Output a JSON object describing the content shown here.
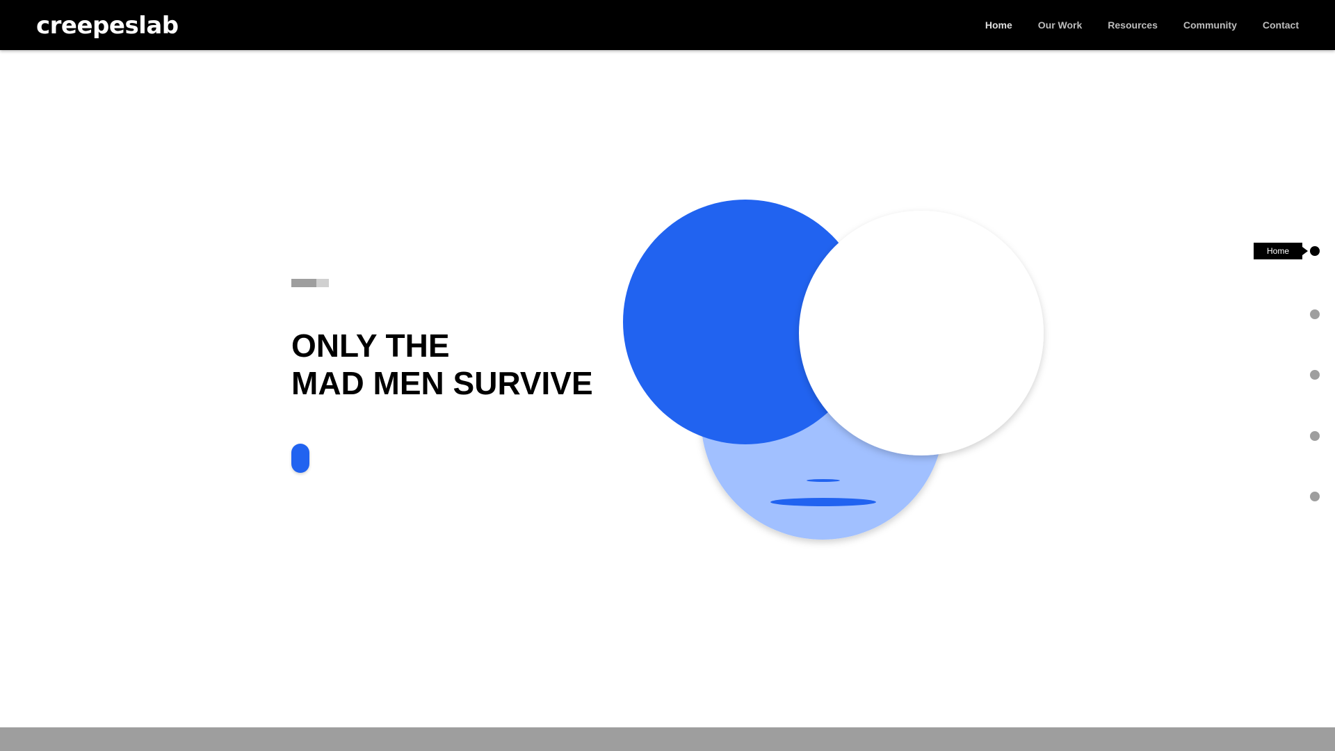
{
  "brand": {
    "logo_text": "creepeslab"
  },
  "nav": {
    "items": [
      {
        "label": "Home"
      },
      {
        "label": "Our Work"
      },
      {
        "label": "Resources"
      },
      {
        "label": "Community"
      },
      {
        "label": "Contact"
      }
    ]
  },
  "hero": {
    "title_line1": "ONLY THE",
    "title_line2": "MAD MEN SURVIVE"
  },
  "section_nav": {
    "tooltip": "Home",
    "active_index": 0,
    "count": 5
  },
  "colors": {
    "accent_blue": "#2163f0",
    "light_blue": "#a1c0ff",
    "header_bg": "#000000",
    "dot_inactive": "#9e9e9e",
    "footer_band": "#9e9e9e"
  }
}
